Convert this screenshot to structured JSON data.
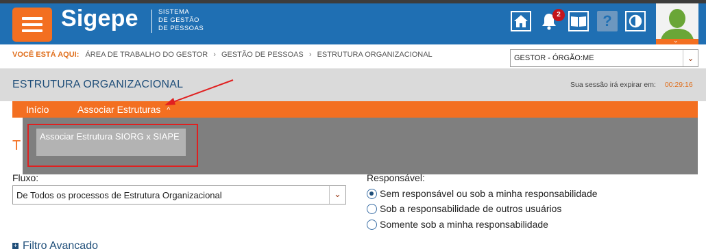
{
  "header": {
    "brand": "Sigepe",
    "brand_sub_line1": "SISTEMA",
    "brand_sub_line2": "DE GESTÃO",
    "brand_sub_line3": "DE PESSOAS",
    "notification_count": "2",
    "help_label": "?",
    "icons": [
      "menu-icon",
      "home-icon",
      "bell-icon",
      "book-icon",
      "help-icon",
      "contrast-icon",
      "user-avatar-icon"
    ],
    "colors": {
      "blue": "#1f6fb3",
      "orange": "#f36f21"
    }
  },
  "breadcrumb": {
    "here_label": "VOCÊ ESTÁ AQUI:",
    "items": [
      "ÁREA DE TRABALHO DO GESTOR",
      "GESTÃO DE PESSOAS",
      "ESTRUTURA ORGANIZACIONAL"
    ],
    "separator": "›"
  },
  "profile_select": {
    "value": "GESTOR - ÓRGÃO:ME"
  },
  "page": {
    "title": "ESTRUTURA ORGANIZACIONAL",
    "session_label": "Sua sessão irá expirar em:",
    "session_time": "00:29:16"
  },
  "menu": {
    "items": [
      "Início",
      "Associar Estruturas"
    ],
    "expanded_caret": "^",
    "dropdown_items": [
      "Associar Estrutura SIORG x SIAPE"
    ]
  },
  "content": {
    "section_title_partial": "T",
    "fluxo_label": "Fluxo:",
    "fluxo_value": "De Todos os processos de Estrutura Organizacional",
    "responsavel_label": "Responsável:",
    "radio_options": [
      {
        "label": "Sem responsável ou sob a minha responsabilidade",
        "checked": true
      },
      {
        "label": "Sob a responsabilidade de outros usuários",
        "checked": false
      },
      {
        "label": "Somente sob a minha responsabilidade",
        "checked": false
      }
    ],
    "filtro_label": "Filtro Avancado"
  }
}
